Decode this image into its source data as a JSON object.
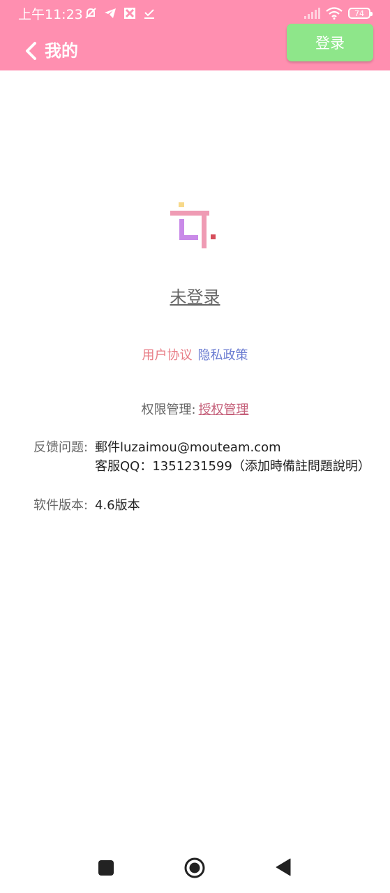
{
  "status_bar": {
    "time": "上午11:23",
    "battery": "74"
  },
  "header": {
    "title": "我的",
    "login_label": "登录"
  },
  "profile": {
    "status": "未登录"
  },
  "agreements": {
    "user_agreement": "用户协议",
    "privacy_policy": "隐私政策"
  },
  "permissions": {
    "label": "权限管理:",
    "link": "授权管理"
  },
  "feedback": {
    "label": "反馈问题:",
    "email": "郵件luzaimou@mouteam.com",
    "qq": "客服QQ：1351231599（添加時備註問題說明）"
  },
  "version": {
    "label": "软件版本:",
    "value": "4.6版本"
  },
  "colors": {
    "header_bg": "#ff8fb0",
    "login_button_bg": "#8ee68a",
    "user_agreement": "#e87d86",
    "privacy_policy": "#6a7bd1",
    "permission_link": "#c5607a"
  }
}
